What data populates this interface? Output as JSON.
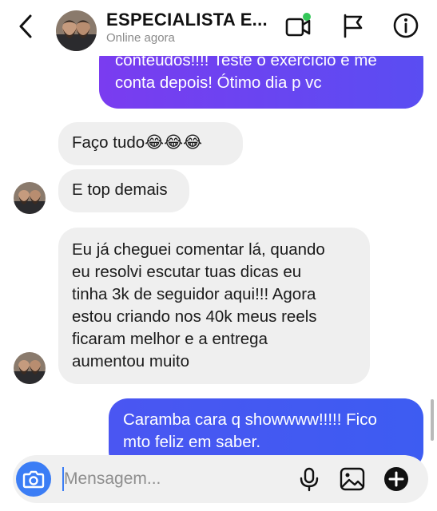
{
  "header": {
    "contact_name": "ESPECIALISTA E...",
    "status": "Online agora"
  },
  "messages": [
    {
      "direction": "outgoing",
      "text": "conteúdos!!!! Teste o exercício e me\nconta depois! Ótimo dia p vc"
    },
    {
      "direction": "incoming",
      "text": "Faço tudo😂😂😂"
    },
    {
      "direction": "incoming",
      "text": "E top demais"
    },
    {
      "direction": "incoming",
      "text": "Eu já cheguei comentar lá, quando\neu resolvi escutar tuas dicas eu\ntinha 3k de seguidor aqui!!! Agora\nestou criando nos 40k meus reels\nficaram melhor e a entrega\naumentou muito"
    },
    {
      "direction": "outgoing",
      "text": "Caramba cara q showwww!!!!! Fico\nmto feliz em saber."
    }
  ],
  "composer": {
    "placeholder": "Mensagem...",
    "value": ""
  },
  "icons": {
    "back": "chevron-left-icon",
    "video_call": "video-call-icon",
    "flag": "flag-icon",
    "info": "info-icon",
    "camera": "camera-icon",
    "microphone": "microphone-icon",
    "gallery": "gallery-icon",
    "add": "plus-circle-icon"
  },
  "colors": {
    "outgoing_gradient_start": "#7a3cf0",
    "outgoing_gradient_end": "#3d5cf2",
    "incoming_bubble": "#efefef",
    "online_dot": "#34c759",
    "camera_button": "#3b7df5"
  }
}
